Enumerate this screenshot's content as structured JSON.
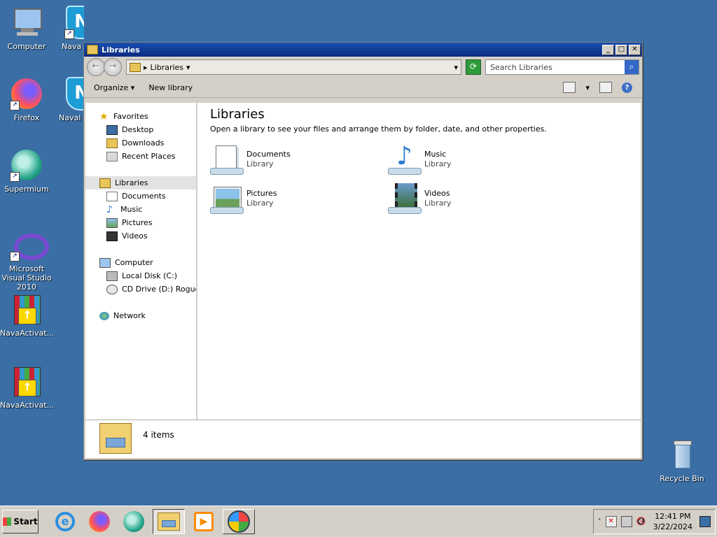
{
  "desktop": {
    "icons": [
      {
        "label": "Computer"
      },
      {
        "label": "Nava"
      },
      {
        "label": "Firefox"
      },
      {
        "label": "NavaI"
      },
      {
        "label": "Supermium"
      },
      {
        "label": "Microsoft Visual Studio 2010"
      },
      {
        "label": "NavaActivat..."
      },
      {
        "label": "NavaActivat..."
      },
      {
        "label": "Recycle Bin"
      }
    ]
  },
  "window": {
    "title": "Libraries",
    "address": "Libraries",
    "search_placeholder": "Search Libraries",
    "toolbar": {
      "organize": "Organize",
      "new_library": "New library"
    },
    "nav": {
      "favorites": "Favorites",
      "favorites_items": [
        "Desktop",
        "Downloads",
        "Recent Places"
      ],
      "libraries": "Libraries",
      "libraries_items": [
        "Documents",
        "Music",
        "Pictures",
        "Videos"
      ],
      "computer": "Computer",
      "computer_items": [
        "Local Disk (C:)",
        "CD Drive (D:) Rogue P"
      ],
      "network": "Network"
    },
    "main": {
      "heading": "Libraries",
      "description": "Open a library to see your files and arrange them by folder, date, and other properties.",
      "libraries": [
        {
          "name": "Documents",
          "kind": "Library"
        },
        {
          "name": "Music",
          "kind": "Library"
        },
        {
          "name": "Pictures",
          "kind": "Library"
        },
        {
          "name": "Videos",
          "kind": "Library"
        }
      ]
    },
    "status": "4 items"
  },
  "taskbar": {
    "start": "Start",
    "time": "12:41 PM",
    "date": "3/22/2024"
  },
  "colors": {
    "desktop": "#3a6ea5",
    "titlebar": "#0a2a80",
    "taskbar": "#d4d0c8"
  }
}
